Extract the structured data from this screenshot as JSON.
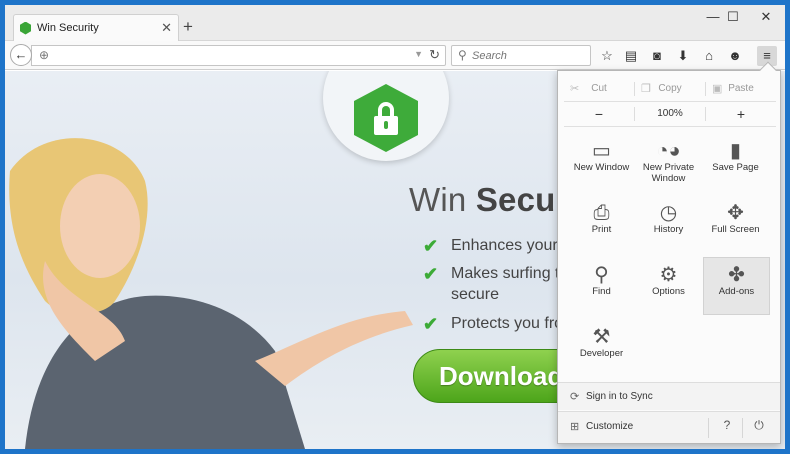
{
  "tab": {
    "title": "Win Security",
    "close": "✕",
    "new_tab": "+"
  },
  "window_controls": {
    "minimize": "—",
    "maximize": "☐",
    "close": "✕"
  },
  "nav": {
    "back": "←",
    "url_value": "",
    "reload": "↻",
    "search_placeholder": "Search"
  },
  "toolbar_icons": [
    "star-icon",
    "reading-list-icon",
    "pocket-icon",
    "download-icon",
    "home-icon",
    "chat-icon",
    "menu-icon"
  ],
  "page": {
    "headline_part1": "Win",
    "headline_part2": "Secur",
    "features": [
      "Enhances your",
      "Makes surfing t",
      "secure",
      "Protects you fro"
    ],
    "download_label": "Download"
  },
  "menu": {
    "edit": {
      "cut": "Cut",
      "copy": "Copy",
      "paste": "Paste"
    },
    "zoom": {
      "minus": "−",
      "value": "100%",
      "plus": "+"
    },
    "items": [
      {
        "label": "New Window",
        "icon": "new-window-icon"
      },
      {
        "label": "New Private Window",
        "icon": "private-mask-icon"
      },
      {
        "label": "Save Page",
        "icon": "save-page-icon"
      },
      {
        "label": "Print",
        "icon": "print-icon"
      },
      {
        "label": "History",
        "icon": "history-icon"
      },
      {
        "label": "Full Screen",
        "icon": "fullscreen-icon"
      },
      {
        "label": "Find",
        "icon": "find-icon"
      },
      {
        "label": "Options",
        "icon": "options-gear-icon"
      },
      {
        "label": "Add-ons",
        "icon": "addons-puzzle-icon"
      },
      {
        "label": "Developer",
        "icon": "developer-wrench-icon"
      }
    ],
    "sign_in": "Sign in to Sync",
    "customize": "Customize",
    "help": "?",
    "quit": "⏻"
  },
  "colors": {
    "accent_green": "#3eab3a",
    "frame_blue": "#1e74c9"
  }
}
